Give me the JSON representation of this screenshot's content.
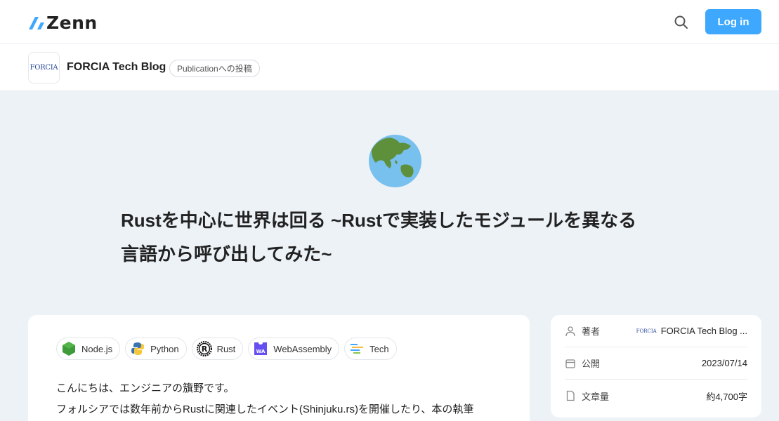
{
  "header": {
    "logo_text": "Zenn",
    "login_label": "Log in"
  },
  "publication": {
    "logo_text": "FORCIA",
    "name": "FORCIA Tech Blog",
    "badge": "Publicationへの投稿"
  },
  "article": {
    "emoji": "globe-asia-australia",
    "title_line1": "Rustを中心に世界は回る ~Rustで実装したモジュールを異なる",
    "title_line2": "言語から呼び出してみた~",
    "tags": [
      {
        "label": "Node.js",
        "icon": "nodejs-icon"
      },
      {
        "label": "Python",
        "icon": "python-icon"
      },
      {
        "label": "Rust",
        "icon": "rust-icon"
      },
      {
        "label": "WebAssembly",
        "icon": "webassembly-icon"
      },
      {
        "label": "Tech",
        "icon": "tech-icon"
      }
    ],
    "body_line1": "こんにちは、エンジニアの籏野です。",
    "body_line2": "フォルシアでは数年前からRustに関連したイベント(Shinjuku.rs)を開催したり、本の執筆"
  },
  "sidebar": {
    "author_label": "著者",
    "author_logo_text": "FORCIA",
    "author_value": "FORCIA Tech Blog ...",
    "published_label": "公開",
    "published_value": "2023/07/14",
    "length_label": "文章量",
    "length_value": "約4,700字"
  },
  "colors": {
    "accent": "#3ea8ff",
    "page_bg": "#edf2f7",
    "text": "#222222"
  }
}
